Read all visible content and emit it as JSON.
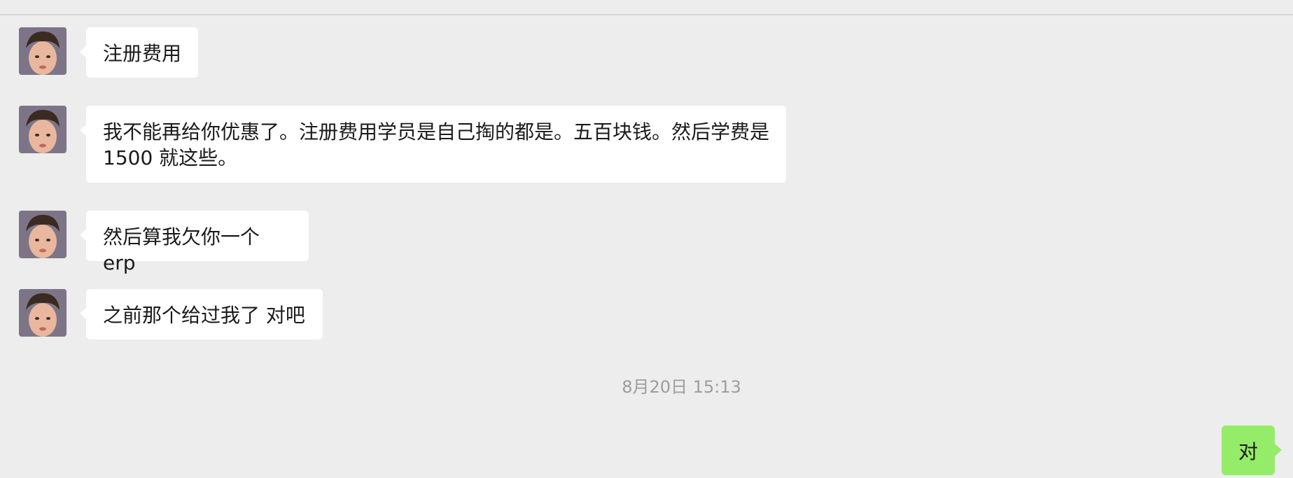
{
  "messages": [
    {
      "side": "left",
      "text": "注册费用"
    },
    {
      "side": "left",
      "text": "我不能再给你优惠了。注册费用学员是自己掏的都是。五百块钱。然后学费是 1500 就这些。"
    },
    {
      "side": "left",
      "text": "然后算我欠你一个erp"
    },
    {
      "side": "left",
      "text": "之前那个给过我了 对吧"
    }
  ],
  "timestamp": "8月20日 15:13",
  "self_message": {
    "side": "right",
    "text": "对"
  },
  "colors": {
    "background": "#ededed",
    "incoming_bubble": "#ffffff",
    "outgoing_bubble": "#95ec69",
    "timestamp_text": "#9d9d9d"
  }
}
